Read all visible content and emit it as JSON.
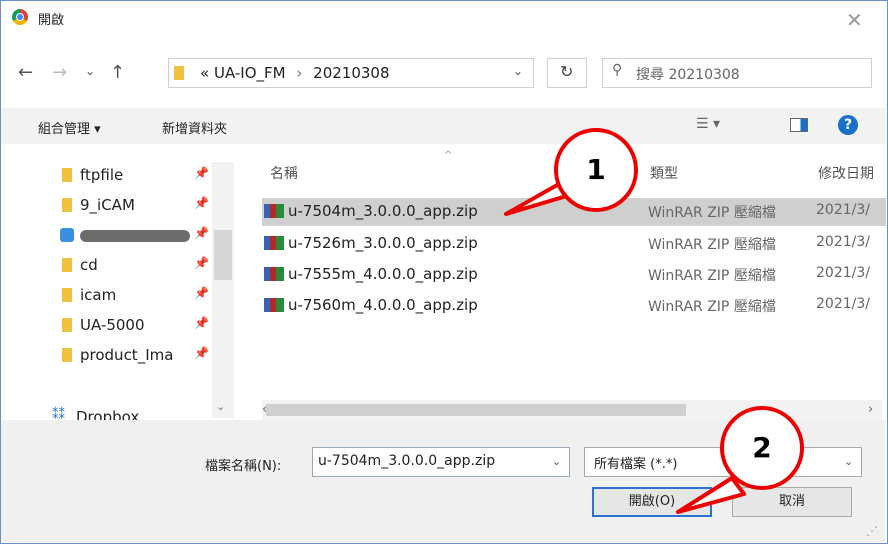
{
  "window": {
    "title": "開啟"
  },
  "address": {
    "separator": "«",
    "crumbs": [
      "UA-IO_FM",
      "20210308"
    ],
    "chevron": "›",
    "search_placeholder": "搜尋 20210308"
  },
  "toolbar": {
    "organize_label": "組合管理 ▾",
    "new_folder_label": "新增資料夾"
  },
  "sidebar": {
    "items": [
      {
        "label": "ftpfile",
        "icon": "folder-icon",
        "pinned": true
      },
      {
        "label": "9_iCAM",
        "icon": "folder-icon",
        "pinned": true
      },
      {
        "label": "",
        "icon": "network-icon",
        "pinned": true
      },
      {
        "label": "cd",
        "icon": "folder-icon",
        "pinned": true
      },
      {
        "label": "icam",
        "icon": "folder-icon",
        "pinned": true
      },
      {
        "label": "UA-5000",
        "icon": "folder-icon",
        "pinned": true
      },
      {
        "label": "product_Ima",
        "icon": "folder-icon",
        "pinned": true
      },
      {
        "label": "Dropbox",
        "icon": "dropbox-icon",
        "pinned": false
      }
    ]
  },
  "file_list": {
    "columns": {
      "name": "名稱",
      "type": "類型",
      "date": "修改日期"
    },
    "rows": [
      {
        "name": "u-7504m_3.0.0.0_app.zip",
        "type": "WinRAR ZIP 壓縮檔",
        "date": "2021/3/",
        "selected": true
      },
      {
        "name": "u-7526m_3.0.0.0_app.zip",
        "type": "WinRAR ZIP 壓縮檔",
        "date": "2021/3/",
        "selected": false
      },
      {
        "name": "u-7555m_4.0.0.0_app.zip",
        "type": "WinRAR ZIP 壓縮檔",
        "date": "2021/3/",
        "selected": false
      },
      {
        "name": "u-7560m_4.0.0.0_app.zip",
        "type": "WinRAR ZIP 壓縮檔",
        "date": "2021/3/",
        "selected": false
      }
    ]
  },
  "bottom": {
    "filename_label": "檔案名稱(N):",
    "filename_value": "u-7504m_3.0.0.0_app.zip",
    "filetype_value": "所有檔案 (*.*)",
    "open_label": "開啟(O)",
    "cancel_label": "取消"
  },
  "callouts": [
    "1",
    "2"
  ],
  "colors": {
    "callout": "#e00000",
    "selection": "#cfcfcf",
    "accent": "#2a73d1"
  }
}
